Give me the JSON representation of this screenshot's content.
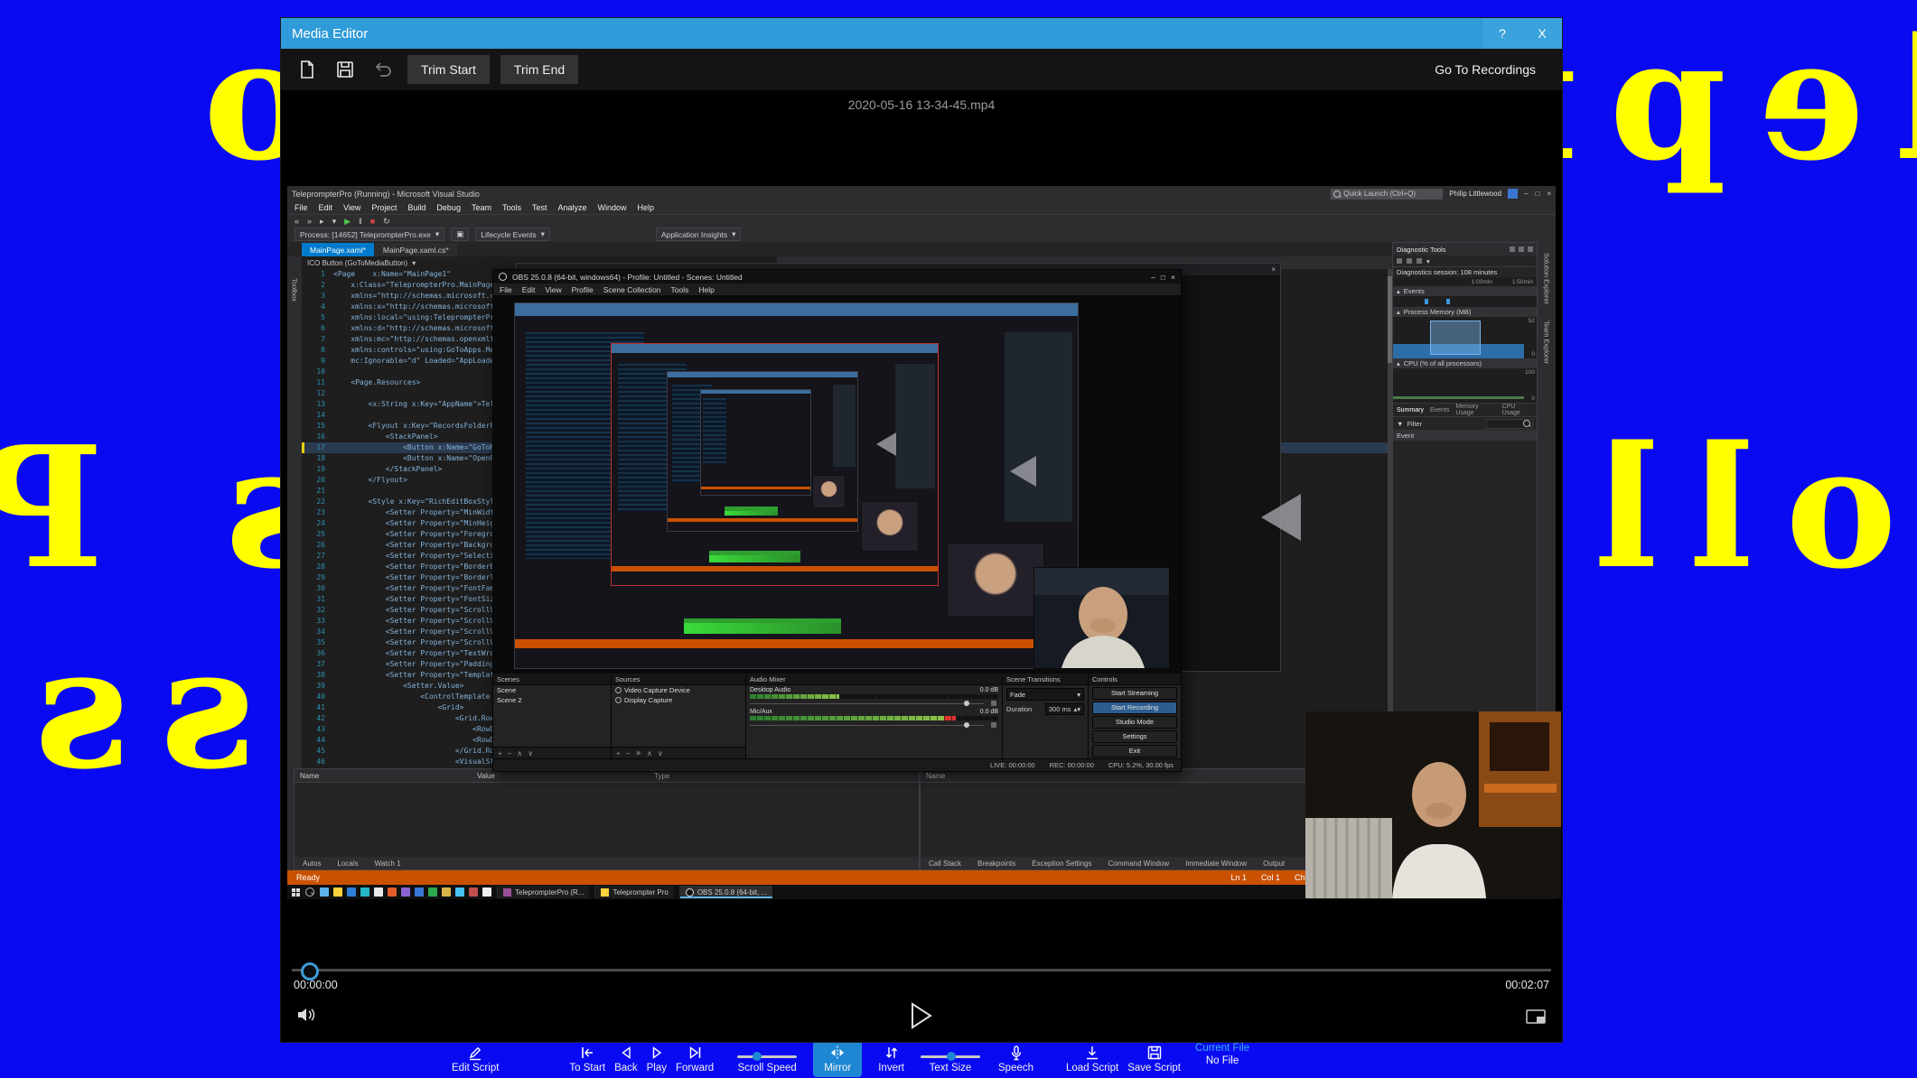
{
  "background": {
    "color": "#0a0af2",
    "text_color": "#ffff00",
    "mirrored_lines": [
      "TeleprompterPro",
      "Scrolling Scripts Pro",
      "Professional"
    ]
  },
  "window": {
    "title": "Media Editor",
    "help": "?",
    "close": "X",
    "toolbar": {
      "trim_start": "Trim Start",
      "trim_end": "Trim End",
      "go_to_recordings": "Go To Recordings"
    },
    "filename": "2020-05-16 13-34-45.mp4",
    "player": {
      "elapsed": "00:00:00",
      "duration": "00:02:07"
    }
  },
  "vs": {
    "titlebar": {
      "title": "TeleprompterPro (Running) - Microsoft Visual Studio",
      "quick_launch": "Quick Launch (Ctrl+Q)",
      "user": "Philip Littlewood"
    },
    "menu": [
      "File",
      "Edit",
      "View",
      "Project",
      "Build",
      "Debug",
      "Team",
      "Tools",
      "Test",
      "Analyze",
      "Window",
      "Help"
    ],
    "debug_row": {
      "process": "Process: [14652] TeleprompterPro.exe",
      "lifecycle": "Lifecycle Events",
      "insights": "Application Insights"
    },
    "tabs": [
      "MainPage.xaml*",
      "MainPage.xaml.cs*"
    ],
    "breadcrumb": "ICO Button (GoToMediaButton)",
    "side_tabs_left": [
      "Toolbox"
    ],
    "side_tabs_right": [
      "Solution Explorer",
      "Team Explorer"
    ],
    "editor": {
      "highlight_line": 17,
      "lines": [
        "<Page    x:Name=\"MainPage1\"",
        "    x:Class=\"TeleprompterPro.MainPage\"",
        "    xmlns=\"http://schemas.microsoft.com/w...\"",
        "    xmlns:x=\"http://schemas.microsoft.co...\"",
        "    xmlns:local=\"using:TeleprompterPro\"",
        "    xmlns:d=\"http://schemas.microsoft.co...\"",
        "    xmlns:mc=\"http://schemas.openxmlform...\"",
        "    xmlns:controls=\"using:GoToApps.Media...\"",
        "    mc:Ignorable=\"d\" Loaded=\"AppLoaded\"",
        "",
        "    <Page.Resources>",
        "",
        "        <x:String x:Key=\"AppName\">Telepro...",
        "",
        "        <Flyout x:Key=\"RecordsFolderFlyout\">",
        "            <StackPanel>",
        "                <Button x:Name=\"GoToMediaB...",
        "                <Button x:Name=\"OpenFolder...",
        "            </StackPanel>",
        "        </Flyout>",
        "",
        "        <Style x:Key=\"RichEditBoxStyle1\" T...",
        "            <Setter Property=\"MinWidth\" Va...",
        "            <Setter Property=\"MinHeight\" V...",
        "            <Setter Property=\"Foreground\" ...",
        "            <Setter Property=\"Background\" ...",
        "            <Setter Property=\"SelectionCol...",
        "            <Setter Property=\"BorderBrush\"...",
        "            <Setter Property=\"BorderThickn...",
        "            <Setter Property=\"FontFamily\" ...",
        "            <Setter Property=\"FontSize\" Va...",
        "            <Setter Property=\"ScrollViewer...",
        "            <Setter Property=\"ScrollViewer...",
        "            <Setter Property=\"ScrollViewer...",
        "            <Setter Property=\"ScrollViewer...",
        "            <Setter Property=\"TextWrapping...",
        "            <Setter Property=\"Padding\" Val...",
        "            <Setter Property=\"Template\">",
        "                <Setter.Value>",
        "                    <ControlTemplate Targe...",
        "                        <Grid>",
        "                            <Grid.RowDefin...",
        "                                <RowDefini...",
        "                                <RowDefini...",
        "                            </Grid.RowDefi...",
        "                            <VisualStateM..."
      ]
    },
    "diagnostics": {
      "title": "Diagnostic Tools",
      "session": "Diagnostics session: 108 minutes",
      "ruler": [
        "1:00min",
        "1:50min"
      ],
      "sections": {
        "events": "Events",
        "memory": "Process Memory (MB)",
        "cpu": "CPU (% of all processors)"
      },
      "memory_scale": [
        "52",
        "0"
      ],
      "cpu_scale": [
        "100",
        "0"
      ],
      "tabs": [
        "Summary",
        "Events",
        "Memory Usage",
        "CPU Usage"
      ],
      "filter": "Filter",
      "event_col": "Event"
    },
    "autos": {
      "columns": [
        "Name",
        "Value",
        "Type"
      ],
      "tabs": [
        "Autos",
        "Locals",
        "Watch 1"
      ]
    },
    "callstack": {
      "columns": [
        "Name"
      ],
      "tabs": [
        "Call Stack",
        "Breakpoints",
        "Exception Settings",
        "Command Window",
        "Immediate Window",
        "Output"
      ]
    },
    "status": {
      "ready": "Ready",
      "right": [
        "Ln 1",
        "Col 1",
        "Ch 1"
      ]
    },
    "taskbar": {
      "icon_colors": [
        "#5fb2e8",
        "#ffd23e",
        "#2f7fd6",
        "#27b7c8",
        "#e8e8e8",
        "#e05c2a",
        "#8a63d2",
        "#3a78d6",
        "#2fa84f",
        "#d8b64a",
        "#48c0f0",
        "#c05050",
        "#f0f0f0"
      ],
      "buttons": [
        "TeleprompterPro (R...",
        "Teleprompter Pro",
        "OBS 25.0.8 (64-bit, ..."
      ]
    }
  },
  "obs": {
    "title": "OBS 25.0.8 (64-bit, windows64) - Profile: Untitled - Scenes: Untitled",
    "menu": [
      "File",
      "Edit",
      "View",
      "Profile",
      "Scene Collection",
      "Tools",
      "Help"
    ],
    "scenes": {
      "title": "Scenes",
      "items": [
        "Scene",
        "Scene 2"
      ]
    },
    "sources": {
      "title": "Sources",
      "items": [
        "Video Capture Device",
        "Display Capture"
      ]
    },
    "mixer": {
      "title": "Audio Mixer",
      "channels": [
        {
          "name": "Desktop Audio",
          "db": "0.0 dB",
          "level": 36
        },
        {
          "name": "Mic/Aux",
          "db": "0.0 dB",
          "level": 78
        }
      ]
    },
    "transitions": {
      "title": "Scene Transitions",
      "type": "Fade",
      "duration_label": "Duration",
      "duration": "300 ms"
    },
    "controls": {
      "title": "Controls",
      "buttons": [
        "Start Streaming",
        "Start Recording",
        "Studio Mode",
        "Settings",
        "Exit"
      ]
    },
    "status": {
      "live": "LIVE: 00:00:00",
      "rec": "REC: 00:00:00",
      "cpu": "CPU: 5.2%, 30.00 fps"
    }
  },
  "app_toolbar": {
    "edit_script": "Edit Script",
    "to_start": "To Start",
    "back": "Back",
    "play": "Play",
    "forward": "Forward",
    "scroll_speed": "Scroll Speed",
    "mirror": "Mirror",
    "invert": "Invert",
    "text_size": "Text Size",
    "speech": "Speech",
    "load_script": "Load Script",
    "save_script": "Save Script",
    "current_file_label": "Current File",
    "current_file_value": "No File"
  }
}
